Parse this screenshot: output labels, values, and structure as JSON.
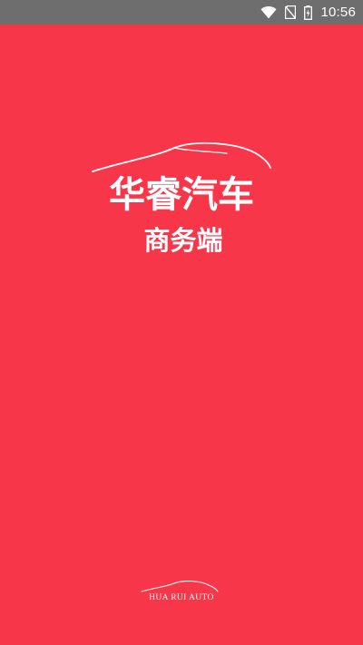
{
  "status_bar": {
    "time": "10:56",
    "icons": [
      "wifi-icon",
      "no-sim-icon",
      "battery-charging-icon"
    ]
  },
  "splash": {
    "brand_title": "华睿汽车",
    "brand_subtitle": "商务端",
    "bottom_logo_text": "HUA RUI AUTO"
  },
  "colors": {
    "background": "#f7364a",
    "status_bar": "#6e6e6e",
    "text": "#ffffff"
  }
}
